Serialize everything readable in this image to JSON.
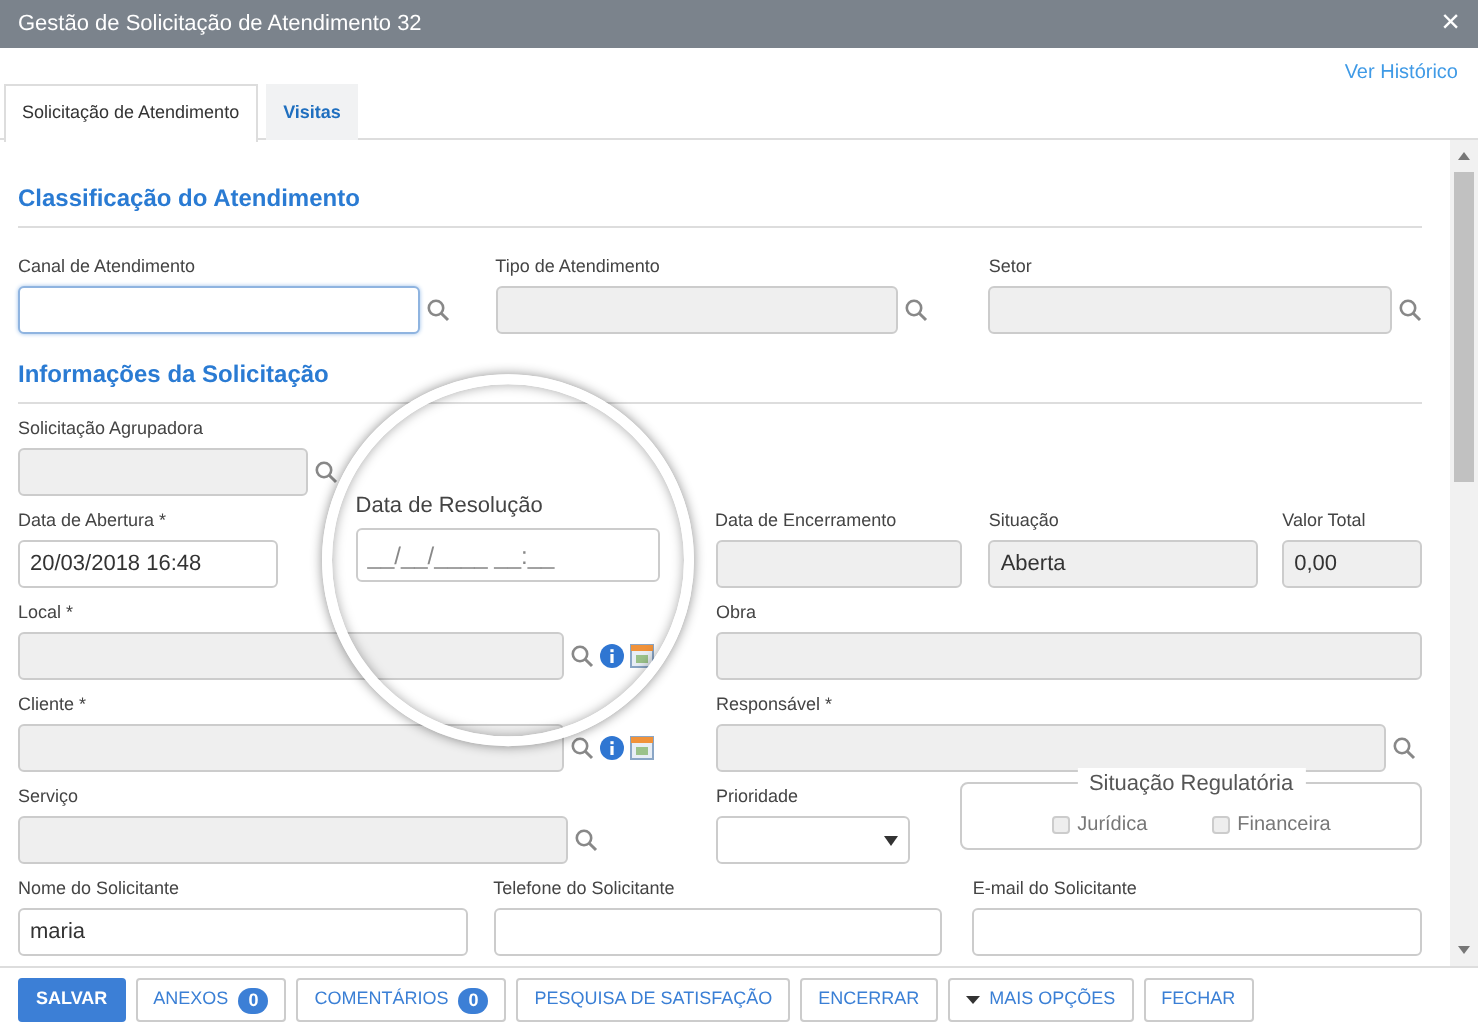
{
  "window": {
    "title": "Gestão de Solicitação de Atendimento 32",
    "close": "×"
  },
  "history_link": "Ver Histórico",
  "tabs": [
    {
      "label": "Solicitação de Atendimento",
      "selected": true
    },
    {
      "label": "Visitas",
      "selected": false
    }
  ],
  "sections": [
    {
      "title": "Classificação do Atendimento",
      "field_lines": [
        {
          "fields": [
            {
              "label": "Canal de Atendimento",
              "kind": "lookup",
              "disabled": false,
              "focused": true,
              "magnified": false
            },
            {
              "label": "Tipo de Atendimento",
              "kind": "lookup",
              "disabled": true,
              "focused": false,
              "magnified": false
            },
            {
              "label": "Setor",
              "kind": "lookup",
              "disabled": true,
              "focused": false,
              "magnified": false
            }
          ]
        }
      ]
    },
    {
      "title": "Informações da Solicitação",
      "field_lines": [
        {
          "fields": [
            {
              "label": "Solicitação Agrupadora",
              "kind": "lookup",
              "disabled": true,
              "focused": false,
              "magnified": false
            }
          ]
        },
        {
          "fields": [
            {
              "label": "Data de Abertura *",
              "kind": "text",
              "value": "20/03/2018 16:48",
              "disabled": false,
              "focused": false,
              "magnified": false
            },
            {
              "label": "Data de Resolução",
              "kind": "text",
              "placeholder": "__/__/____ __:__",
              "disabled": false,
              "focused": false,
              "magnified": true
            },
            {
              "label": "Data de Encerramento",
              "kind": "text",
              "disabled": true,
              "focused": false,
              "magnified": false
            },
            {
              "label": "Situação",
              "kind": "text",
              "value": "Aberta",
              "disabled": true,
              "focused": false,
              "magnified": false
            },
            {
              "label": "Valor Total",
              "kind": "text",
              "value": "0,00",
              "disabled": true,
              "focused": false,
              "magnified": false
            }
          ]
        },
        {
          "fields": [
            {
              "label": "Local *",
              "kind": "lookup_detail",
              "disabled": true,
              "focused": false,
              "magnified": false
            },
            {
              "label": "Obra",
              "kind": "text",
              "disabled": true,
              "focused": false,
              "magnified": false
            }
          ]
        },
        {
          "fields": [
            {
              "label": "Cliente *",
              "kind": "lookup_detail",
              "disabled": true,
              "focused": false,
              "magnified": false
            },
            {
              "label": "Responsável *",
              "kind": "lookup",
              "disabled": true,
              "focused": false,
              "magnified": false
            }
          ]
        },
        {
          "fields": [
            {
              "label": "Serviço",
              "kind": "lookup",
              "disabled": true,
              "focused": false,
              "magnified": false
            },
            {
              "label": "Prioridade",
              "kind": "select",
              "disabled": false,
              "focused": false,
              "magnified": false
            },
            {
              "label": "Situação Regulatória",
              "kind": "checkgroup",
              "options": [
                {
                  "label": "Jurídica",
                  "checked": false,
                  "disabled": true
                },
                {
                  "label": "Financeira",
                  "checked": false,
                  "disabled": true
                }
              ]
            }
          ]
        },
        {
          "fields": [
            {
              "label": "Nome do Solicitante",
              "kind": "text",
              "value": "maria",
              "disabled": false,
              "focused": false,
              "magnified": false
            },
            {
              "label": "Telefone do Solicitante",
              "kind": "text",
              "disabled": false,
              "focused": false,
              "magnified": false
            },
            {
              "label": "E-mail do Solicitante",
              "kind": "text",
              "disabled": false,
              "focused": false,
              "magnified": false
            }
          ]
        }
      ]
    }
  ],
  "footer_buttons": [
    {
      "label": "SALVAR",
      "kind": "primary"
    },
    {
      "label": "ANEXOS",
      "kind": "count",
      "count": "0"
    },
    {
      "label": "COMENTÁRIOS",
      "kind": "count",
      "count": "0"
    },
    {
      "label": "PESQUISA DE SATISFAÇÃO",
      "kind": "plain"
    },
    {
      "label": "ENCERRAR",
      "kind": "plain"
    },
    {
      "label": "MAIS OPÇÕES",
      "kind": "menu"
    },
    {
      "label": "FECHAR",
      "kind": "plain"
    }
  ]
}
